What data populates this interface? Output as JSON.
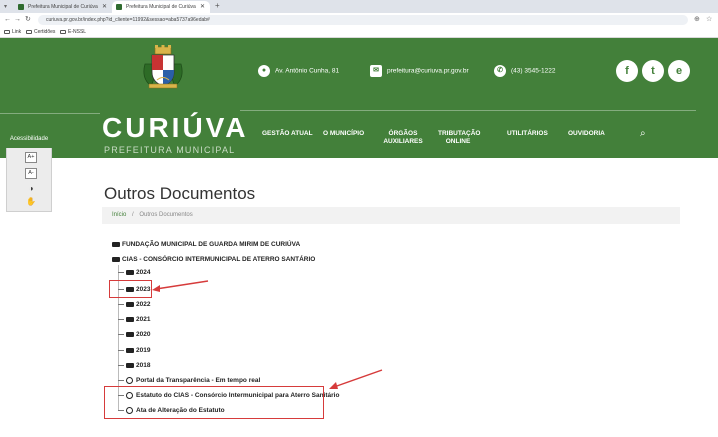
{
  "browser": {
    "tabs": [
      {
        "label": "Prefeitura Municipal de Curiúva"
      },
      {
        "label": "Prefeitura Municipal de Curiúva"
      }
    ],
    "url": "curiuva.pr.gov.br/index.php?id_cliente=11992&sessao=aba5737a96edab#",
    "bookmarks": [
      {
        "label": "Link"
      },
      {
        "label": "Certidões"
      },
      {
        "label": "E-NSSL"
      }
    ]
  },
  "header": {
    "address": "Av. Antônio Cunha, 81",
    "email": "prefeitura@curiuva.pr.gov.br",
    "phone": "(43) 3545-1222",
    "brand_name": "CURIÚVA",
    "brand_sub": "PREFEITURA MUNICIPAL",
    "social": [
      "f",
      "t",
      "e"
    ],
    "menu": [
      {
        "label": "GESTÃO ATUAL"
      },
      {
        "label": "O MUNICÍPIO"
      },
      {
        "label": "ÓRGÃOS AUXILIARES"
      },
      {
        "label": "TRIBUTAÇÃO ONLINE"
      },
      {
        "label": "UTILITÁRIOS"
      },
      {
        "label": "OUVIDORIA"
      }
    ]
  },
  "accessibility": {
    "title": "Acessibilidade",
    "buttons": [
      "A+",
      "A-",
      "◑",
      "✋"
    ]
  },
  "content": {
    "title": "Outros Documentos",
    "breadcrumb_home": "Início",
    "breadcrumb_sep": "/",
    "breadcrumb_current": "Outros Documentos",
    "tree": {
      "fundacao": "FUNDAÇÃO MUNICIPAL DE GUARDA MIRIM DE CURIÚVA",
      "cias": "CIAS - CONSÓRCIO INTERMUNICIPAL DE ATERRO SANTÁRIO",
      "years": [
        "2024",
        "2023",
        "2022",
        "2021",
        "2020",
        "2019",
        "2018"
      ],
      "links": [
        "Portal da Transparência - Em tempo real",
        "Estatuto do CIAS - Consórcio Intermunicipal para Aterro Sanitário",
        "Ata de Alteração do Estatuto"
      ]
    }
  },
  "colors": {
    "brand_green": "#43803a",
    "annotation_red": "#d63b3b"
  }
}
